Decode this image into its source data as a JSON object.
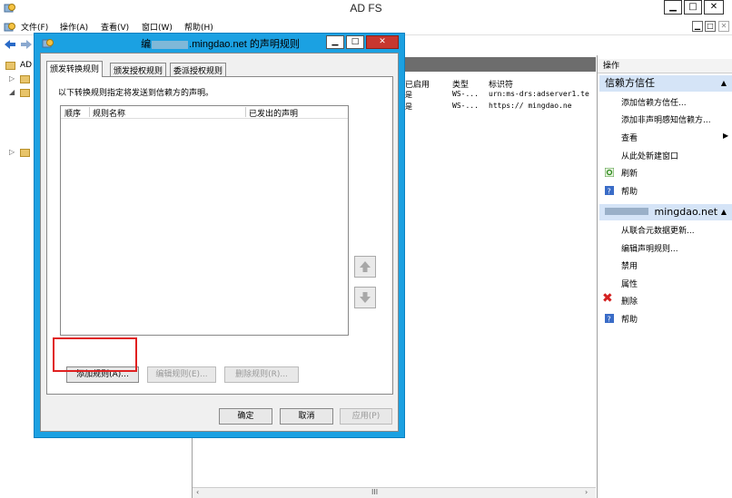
{
  "window": {
    "title": "AD FS",
    "min": "▁",
    "max": "□",
    "close": "✕"
  },
  "menu": {
    "items": [
      "文件(F)",
      "操作(A)",
      "查看(V)",
      "窗口(W)",
      "帮助(H)"
    ]
  },
  "tree": {
    "items": [
      "AD"
    ]
  },
  "center": {
    "columns": [
      "已启用",
      "类型",
      "标识符"
    ],
    "rows": [
      {
        "enabled": "是",
        "type": "WS-...",
        "identifier": "urn:ms-drs:adserver1.te"
      },
      {
        "enabled": "是",
        "type": "WS-...",
        "identifier": "https://        mingdao.ne"
      }
    ],
    "scroll_mid": "III"
  },
  "actions": {
    "header": "操作",
    "section1": {
      "title": "信赖方信任",
      "items": [
        "添加信赖方信任...",
        "添加非声明感知信赖方...",
        "查看",
        "从此处新建窗口",
        "刷新",
        "帮助"
      ]
    },
    "section2": {
      "title": "mingdao.net",
      "items": [
        "从联合元数据更新...",
        "编辑声明规则...",
        "禁用",
        "属性",
        "删除",
        "帮助"
      ]
    }
  },
  "dialog": {
    "title_prefix": "编",
    "title_suffix": ".mingdao.net 的声明规则",
    "min": "▁",
    "max": "□",
    "close": "✕",
    "tabs": [
      "颁发转换规则",
      "颁发授权规则",
      "委派授权规则"
    ],
    "instruction": "以下转换规则指定将发送到信赖方的声明。",
    "list_columns": [
      "顺序",
      "规则名称",
      "已发出的声明"
    ],
    "buttons": {
      "add": "添加规则(A)...",
      "edit": "编辑规则(E)...",
      "delete": "删除规则(R)...",
      "ok": "确定",
      "cancel": "取消",
      "apply": "应用(P)"
    }
  },
  "colors": {
    "dialog_frame": "#1ba1e2",
    "section_head": "#d5e4f7",
    "highlight": "#e02020",
    "close_red": "#c7372f"
  }
}
